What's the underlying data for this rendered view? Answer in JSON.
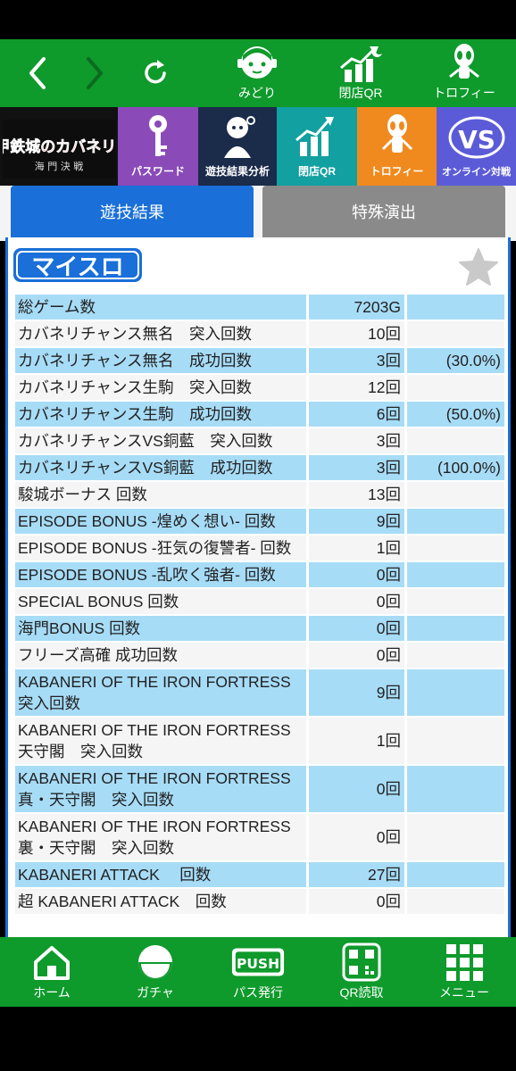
{
  "top_nav": {
    "tools": [
      {
        "label": "みどり",
        "icon": "midori-character-icon"
      },
      {
        "label": "閉店QR",
        "icon": "closing-qr-chart-icon"
      },
      {
        "label": "トロフィー",
        "icon": "trophy-alien-icon"
      }
    ]
  },
  "banner": {
    "game_logo": "甲鉄城のカバネリ!",
    "game_logo_sub": "海 門 決 戦",
    "tiles": [
      {
        "label": "パスワード",
        "color": "#8a4ab8"
      },
      {
        "label": "遊技結果分析",
        "color": "#1b2b4a"
      },
      {
        "label": "閉店QR",
        "color": "#12a0a0"
      },
      {
        "label": "トロフィー",
        "color": "#f08a1e"
      },
      {
        "label": "オンライン対戦",
        "color": "#5b5bd8"
      }
    ]
  },
  "tabs": {
    "active": "遊技結果",
    "inactive": "特殊演出"
  },
  "panel": {
    "logo": "マイスロ"
  },
  "results": [
    {
      "label": "総ゲーム数",
      "value": "7203G",
      "pct": ""
    },
    {
      "label": "カバネリチャンス無名　突入回数",
      "value": "10回",
      "pct": ""
    },
    {
      "label": "カバネリチャンス無名　成功回数",
      "value": "3回",
      "pct": "(30.0%)"
    },
    {
      "label": "カバネリチャンス生駒　突入回数",
      "value": "12回",
      "pct": ""
    },
    {
      "label": "カバネリチャンス生駒　成功回数",
      "value": "6回",
      "pct": "(50.0%)"
    },
    {
      "label": "カバネリチャンスVS銅藍　突入回数",
      "value": "3回",
      "pct": ""
    },
    {
      "label": "カバネリチャンスVS銅藍　成功回数",
      "value": "3回",
      "pct": "(100.0%)"
    },
    {
      "label": "駿城ボーナス 回数",
      "value": "13回",
      "pct": ""
    },
    {
      "label": "EPISODE BONUS -煌めく想い- 回数",
      "value": "9回",
      "pct": ""
    },
    {
      "label": "EPISODE BONUS -狂気の復讐者- 回数",
      "value": "1回",
      "pct": ""
    },
    {
      "label": "EPISODE BONUS -乱吹く強者- 回数",
      "value": "0回",
      "pct": ""
    },
    {
      "label": "SPECIAL BONUS 回数",
      "value": "0回",
      "pct": ""
    },
    {
      "label": "海門BONUS 回数",
      "value": "0回",
      "pct": ""
    },
    {
      "label": "フリーズ高確 成功回数",
      "value": "0回",
      "pct": ""
    },
    {
      "label": "KABANERI OF THE IRON FORTRESS 突入回数",
      "value": "9回",
      "pct": ""
    },
    {
      "label": "KABANERI OF THE IRON FORTRESS 天守閣　突入回数",
      "value": "1回",
      "pct": ""
    },
    {
      "label": "KABANERI OF THE IRON FORTRESS 真・天守閣　突入回数",
      "value": "0回",
      "pct": ""
    },
    {
      "label": "KABANERI OF THE IRON FORTRESS 裏・天守閣　突入回数",
      "value": "0回",
      "pct": ""
    },
    {
      "label": "KABANERI ATTACK　 回数",
      "value": "27回",
      "pct": ""
    },
    {
      "label": "超 KABANERI ATTACK　回数",
      "value": "0回",
      "pct": ""
    }
  ],
  "bottom_nav": [
    {
      "label": "ホーム",
      "icon": "home-icon"
    },
    {
      "label": "ガチャ",
      "icon": "gacha-capsule-icon"
    },
    {
      "label": "パス発行",
      "icon": "push-ticket-icon"
    },
    {
      "label": "QR読取",
      "icon": "qr-code-icon"
    },
    {
      "label": "メニュー",
      "icon": "menu-grid-icon"
    }
  ],
  "colors": {
    "brand_green": "#0f9a2c",
    "tab_blue": "#1a6fd8",
    "row_blue": "#a7dcf7"
  }
}
